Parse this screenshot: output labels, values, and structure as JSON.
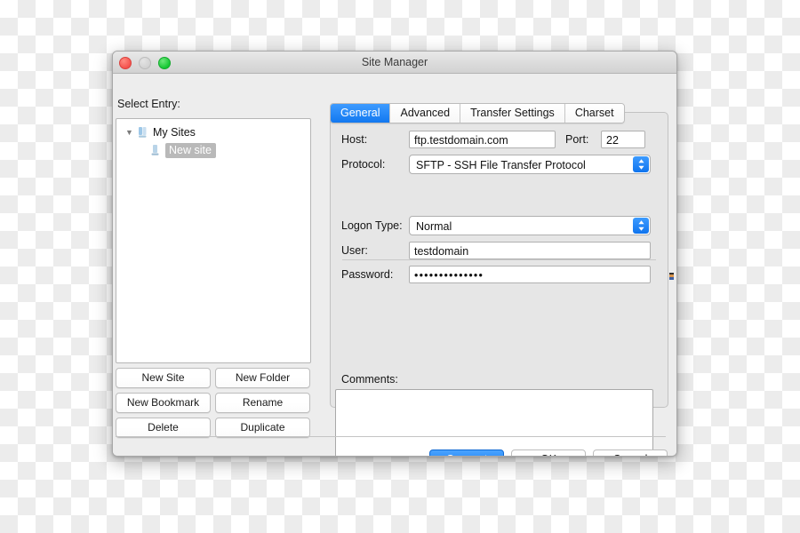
{
  "window": {
    "title": "Site Manager",
    "traffic_lights": [
      "close-light",
      "minimize-light",
      "zoom-light"
    ]
  },
  "left_pane": {
    "label": "Select Entry:",
    "tree": [
      {
        "label": "My Sites",
        "icon": "server-icon",
        "expanded": true,
        "selected": false,
        "disclosure": "▼"
      },
      {
        "label": "New site",
        "icon": "server-icon",
        "expanded": false,
        "selected": true,
        "disclosure": ""
      }
    ],
    "buttons": [
      "New Site",
      "New Folder",
      "New Bookmark",
      "Rename",
      "Delete",
      "Duplicate"
    ]
  },
  "tabs": [
    {
      "label": "General",
      "active": true
    },
    {
      "label": "Advanced",
      "active": false
    },
    {
      "label": "Transfer Settings",
      "active": false
    },
    {
      "label": "Charset",
      "active": false
    }
  ],
  "form": {
    "host_label": "Host:",
    "host_value": "ftp.testdomain.com",
    "port_label": "Port:",
    "port_value": "22",
    "protocol_label": "Protocol:",
    "protocol_value": "SFTP - SSH File Transfer Protocol",
    "logon_type_label": "Logon Type:",
    "logon_type_value": "Normal",
    "user_label": "User:",
    "user_value": "testdomain",
    "password_label": "Password:",
    "password_value": "••••••••••••••",
    "comments_label": "Comments:",
    "comments_value": ""
  },
  "footer": {
    "connect_label": "Connect",
    "ok_label": "OK",
    "cancel_label": "Cancel"
  },
  "colors": {
    "accent_blue": "#1278f0",
    "window_bg": "#ededed",
    "selection_gray": "#b9b9b9"
  }
}
